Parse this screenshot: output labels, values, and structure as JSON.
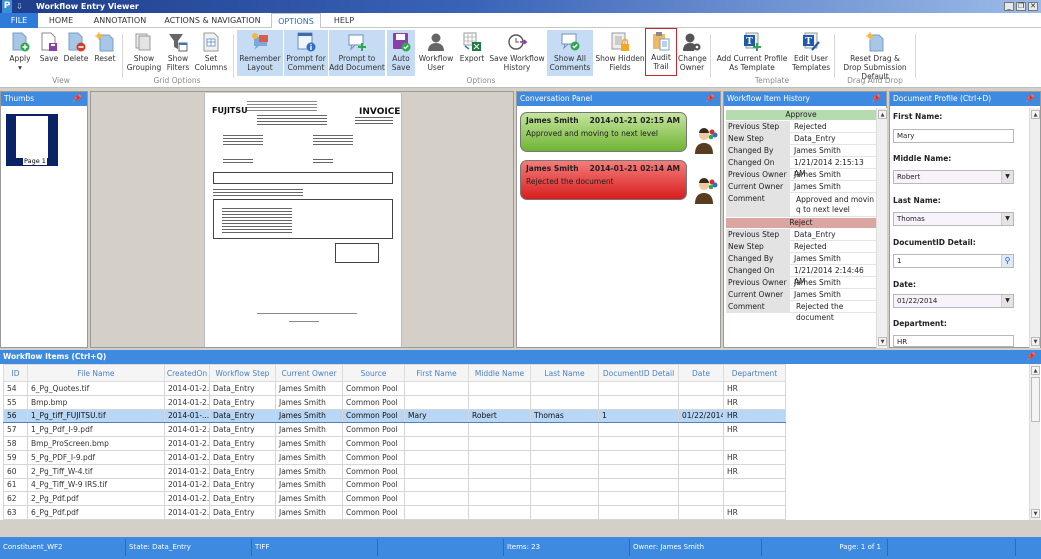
{
  "window": {
    "title": "Workflow Entry Viewer",
    "app_logo": "P",
    "quick_access": "⇩",
    "controls": [
      "minimize",
      "restore",
      "close"
    ]
  },
  "ribbon_tabs": [
    {
      "label": "FILE",
      "state": "file"
    },
    {
      "label": "HOME"
    },
    {
      "label": "ANNOTATION"
    },
    {
      "label": "ACTIONS & NAVIGATION"
    },
    {
      "label": "OPTIONS",
      "state": "active"
    },
    {
      "label": "HELP"
    }
  ],
  "ribbon": {
    "buttons": [
      {
        "label": "Apply ▾",
        "icon": "apply-doc-plus-icon"
      },
      {
        "label": "Save",
        "icon": "save-doc-icon"
      },
      {
        "label": "Delete",
        "icon": "delete-doc-icon"
      },
      {
        "label": "Reset",
        "icon": "reset-sparkle-icon"
      },
      {
        "label": "Show Grouping",
        "icon": "grouping-icon"
      },
      {
        "label": "Show Filters",
        "icon": "filter-funnel-icon"
      },
      {
        "label": "Set Columns",
        "icon": "columns-icon"
      },
      {
        "label": "Remember Layout",
        "icon": "remember-layout-icon",
        "selected": true
      },
      {
        "label": "Prompt for Comment",
        "icon": "prompt-comment-icon",
        "selected": true
      },
      {
        "label": "Prompt to Add Document",
        "icon": "prompt-add-doc-icon",
        "selected": true
      },
      {
        "label": "Auto Save",
        "icon": "auto-save-icon",
        "selected": true
      },
      {
        "label": "Workflow User",
        "icon": "user-icon"
      },
      {
        "label": "Export",
        "icon": "export-excel-icon"
      },
      {
        "label": "Save Workflow History",
        "icon": "history-clock-icon"
      },
      {
        "label": "Show All Comments",
        "icon": "comments-check-icon",
        "selected": true
      },
      {
        "label": "Show Hidden Fields",
        "icon": "hidden-fields-lock-icon"
      },
      {
        "label": "Audit Trail",
        "icon": "clipboard-icon",
        "outlined": true
      },
      {
        "label": "Change Owner",
        "icon": "change-owner-gear-icon"
      },
      {
        "label": "Add Current Profile As Template",
        "icon": "template-add-icon"
      },
      {
        "label": "Edit User Templates",
        "icon": "template-edit-icon"
      },
      {
        "label": "Reset Drag & Drop Submission Default",
        "icon": "reset-drag-drop-icon"
      }
    ],
    "groups": [
      "View",
      "Grid Options",
      "Options",
      "Template",
      "Drag And Drop"
    ]
  },
  "thumbs": {
    "title": "Thumbs",
    "page_label": "Page 1"
  },
  "document": {
    "brand": "FUJITSU",
    "heading": "INVOICE"
  },
  "conversation": {
    "title": "Conversation Panel",
    "messages": [
      {
        "author": "James Smith",
        "timestamp": "2014-01-21 02:15 AM",
        "text": "Approved and moving to next level",
        "color": "#7fc040"
      },
      {
        "author": "James Smith",
        "timestamp": "2014-01-21 02:14 AM",
        "text": "Rejected the document",
        "color": "#e02a2a"
      }
    ]
  },
  "history": {
    "title": "Workflow Item History",
    "entries": [
      {
        "action": "Approve",
        "color": "#b6dbb0",
        "rows": [
          {
            "key": "Previous Step",
            "value": "Rejected"
          },
          {
            "key": "New Step",
            "value": "Data_Entry"
          },
          {
            "key": "Changed By",
            "value": "James Smith"
          },
          {
            "key": "Changed On",
            "value": "1/21/2014 2:15:13 AM"
          },
          {
            "key": "Previous Owner",
            "value": "James Smith"
          },
          {
            "key": "Current Owner",
            "value": "James Smith"
          },
          {
            "key": "Comment",
            "value": "Approved and movin q to next level"
          }
        ]
      },
      {
        "action": "Reject",
        "color": "#dba6a2",
        "rows": [
          {
            "key": "Previous Step",
            "value": "Data_Entry"
          },
          {
            "key": "New Step",
            "value": "Rejected"
          },
          {
            "key": "Changed By",
            "value": "James Smith"
          },
          {
            "key": "Changed On",
            "value": "1/21/2014 2:14:46 AM"
          },
          {
            "key": "Previous Owner",
            "value": "James Smith"
          },
          {
            "key": "Current Owner",
            "value": "James Smith"
          },
          {
            "key": "Comment",
            "value": "Rejected the document"
          }
        ]
      }
    ]
  },
  "profile": {
    "title": "Document Profile (Ctrl+D)",
    "fields": [
      {
        "label": "First Name:",
        "value": "Mary",
        "type": "text"
      },
      {
        "label": "Middle Name:",
        "value": "Robert",
        "type": "dropdown"
      },
      {
        "label": "Last Name:",
        "value": "Thomas",
        "type": "dropdown"
      },
      {
        "label": "DocumentID Detail:",
        "value": "1",
        "type": "lookup"
      },
      {
        "label": "Date:",
        "value": "01/22/2014",
        "type": "dropdown"
      },
      {
        "label": "Department:",
        "value": "HR",
        "type": "text"
      }
    ]
  },
  "grid": {
    "title": "Workflow Items (Ctrl+Q)",
    "columns": [
      "ID",
      "File Name",
      "CreatedOn",
      "Workflow Step",
      "Current Owner",
      "Source",
      "First Name",
      "Middle Name",
      "Last Name",
      "DocumentID Detail",
      "Date",
      "Department"
    ],
    "rows": [
      [
        "54",
        "6_Pg_Quotes.tif",
        "2014-01-2...",
        "Data_Entry",
        "James Smith",
        "Common Pool",
        "",
        "",
        "",
        "",
        "",
        "HR"
      ],
      [
        "55",
        "Bmp.bmp",
        "2014-01-2...",
        "Data_Entry",
        "James Smith",
        "Common Pool",
        "",
        "",
        "",
        "",
        "",
        "HR"
      ],
      [
        "56",
        "1_Pg_tiff_FUJITSU.tif",
        "2014-01-...",
        "Data_Entry",
        "James Smith",
        "Common Pool",
        "Mary",
        "Robert",
        "Thomas",
        "1",
        "01/22/2014",
        "HR"
      ],
      [
        "57",
        "1_Pg_Pdf_I-9.pdf",
        "2014-01-2...",
        "Data_Entry",
        "James Smith",
        "Common Pool",
        "",
        "",
        "",
        "",
        "",
        "HR"
      ],
      [
        "58",
        "Bmp_ProScreen.bmp",
        "2014-01-2...",
        "Data_Entry",
        "James Smith",
        "Common Pool",
        "",
        "",
        "",
        "",
        "",
        ""
      ],
      [
        "59",
        "5_Pg_PDF_I-9.pdf",
        "2014-01-2...",
        "Data_Entry",
        "James Smith",
        "Common Pool",
        "",
        "",
        "",
        "",
        "",
        "HR"
      ],
      [
        "60",
        "2_Pg_Tiff_W-4.tif",
        "2014-01-2...",
        "Data_Entry",
        "James Smith",
        "Common Pool",
        "",
        "",
        "",
        "",
        "",
        "HR"
      ],
      [
        "61",
        "4_Pg_Tiff_W-9 IRS.tif",
        "2014-01-2...",
        "Data_Entry",
        "James Smith",
        "Common Pool",
        "",
        "",
        "",
        "",
        "",
        ""
      ],
      [
        "62",
        "2_Pg_Pdf.pdf",
        "2014-01-2...",
        "Data_Entry",
        "James Smith",
        "Common Pool",
        "",
        "",
        "",
        "",
        "",
        ""
      ],
      [
        "63",
        "6_Pg_Pdf.pdf",
        "2014-01-2...",
        "Data_Entry",
        "James Smith",
        "Common Pool",
        "",
        "",
        "",
        "",
        "",
        "HR"
      ]
    ],
    "selected_row": 2
  },
  "status": {
    "cells": [
      "Constituent_WF2",
      "State: Data_Entry",
      "TIFF",
      "",
      "Items: 23",
      "Owner: James Smith",
      "Page: 1 of 1",
      ""
    ]
  },
  "colors": {
    "accent": "#3d8ae0",
    "ribbon_selected": "#c5dcf4",
    "audit_outline": "#c8282c"
  }
}
